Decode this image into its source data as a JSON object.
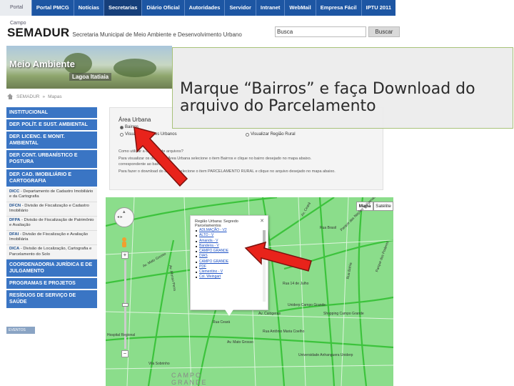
{
  "nav": {
    "first": "Portal Campo",
    "items": [
      "Portal PMCG",
      "Notícias",
      "Secretarias",
      "Diário Oficial",
      "Autoridades",
      "Servidor",
      "Intranet",
      "WebMail",
      "Empresa Fácil",
      "IPTU 2011"
    ]
  },
  "header": {
    "brand": "SEMADUR",
    "subtitle": "Secretaria Municipal de Meio Ambiente e Desenvolvimento Urbano",
    "search_value": "Busca",
    "search_button": "Buscar"
  },
  "banner": {
    "title": "Meio Ambiente",
    "subtitle": "Lagoa Itatiaia"
  },
  "breadcrumb": [
    "SEMADUR",
    "»",
    "Mapas"
  ],
  "sidebar": {
    "sections": [
      {
        "label": "INSTITUCIONAL",
        "children": []
      },
      {
        "label": "DEP. POLÍT. E SUST. AMBIENTAL",
        "children": []
      },
      {
        "label": "DEP. LICENC. E MONIT. AMBIENTAL",
        "children": []
      },
      {
        "label": "DEP. CONT. URBANÍSTICO E POSTURA",
        "children": []
      },
      {
        "label": "DEP. CAD. IMOBILIÁRIO E CARTOGRAFIA",
        "children": [
          {
            "code": "DICC",
            "text": "Departamento de Cadastro Imobiliário e da Cartografia"
          },
          {
            "code": "DFCN",
            "text": "Divisão de Fiscalização e Cadastro Imobiliário"
          },
          {
            "code": "DFPA",
            "text": "Divisão de Fiscalização de Patrimônio e Avaliação"
          },
          {
            "code": "DFAI",
            "text": "Divisão de Fiscalização e Avaliação Imobiliária"
          },
          {
            "code": "DICA",
            "text": "Divisão de Localização, Cartografia e Parcelamento do Solo"
          }
        ]
      },
      {
        "label": "COORDENADORIA JURÍDICA E DE JULGAMENTO",
        "children": []
      },
      {
        "label": "PROGRAMAS E PROJETOS",
        "children": []
      },
      {
        "label": "RESÍDUOS DE SERVIÇO DE SAÚDE",
        "children": []
      }
    ],
    "bottom_label": "EVENTOS"
  },
  "area": {
    "title": "Área Urbana",
    "options": [
      "Bairros",
      "Visualizar Setores Urbanos",
      "Visualizar Região Rural"
    ],
    "paragraphs": [
      "Como utilizar a camada de arquivos?",
      "Para visualizar os dados da Área Urbana selecione o item Bairros e clique no bairro desejado no mapa abaixo.",
      "correspondente ao bairro.",
      "Para fazer o download do arquivo selecione o item PARCELAMENTO RURAL e clique no arquivo desejado no mapa abaixo."
    ]
  },
  "callout": {
    "text": "Marque “Bairros” e faça  Download do arquivo  do Parcelamento"
  },
  "map": {
    "type_buttons": [
      "Mapa",
      "Satélite"
    ],
    "popup": {
      "title": "Região Urbana: Segredo",
      "subtitle": "Parcelamentos",
      "items": [
        "ADLMAÇÃO - V2",
        "ALTO - V",
        "Amanda - V",
        "Bandeira - V",
        "CAMPO GRANDE",
        "DIAS",
        "CAMPO GRANDE",
        "PDF",
        "Clementino - V",
        "Col. Weingart"
      ]
    },
    "labels": [
      "Av. Ceará",
      "Rua Brasil",
      "Parque das Nações Indígenas",
      "Av. Mato Grosso",
      "Av. Afonso Pena",
      "Rua Bahia",
      "Rua 14 de Julho",
      "Av. Calógeras",
      "Uniderp Campo Grande",
      "Shopping Campo Grande",
      "Parque dos Poderes",
      "Hospital Regional",
      "Universidade Anhanguera Uniderp",
      "Rua Ceará",
      "Av. Mato Grosso",
      "Rua Antônio Maria Coelho",
      "Vila Sobrinho",
      "CAMPO",
      "GRANDE"
    ]
  },
  "colors": {
    "nav_bg": "#1d56a3",
    "sidebar_head": "#3a75c4",
    "map_bg": "#8bdd8b",
    "arrow": "#e8231b"
  }
}
